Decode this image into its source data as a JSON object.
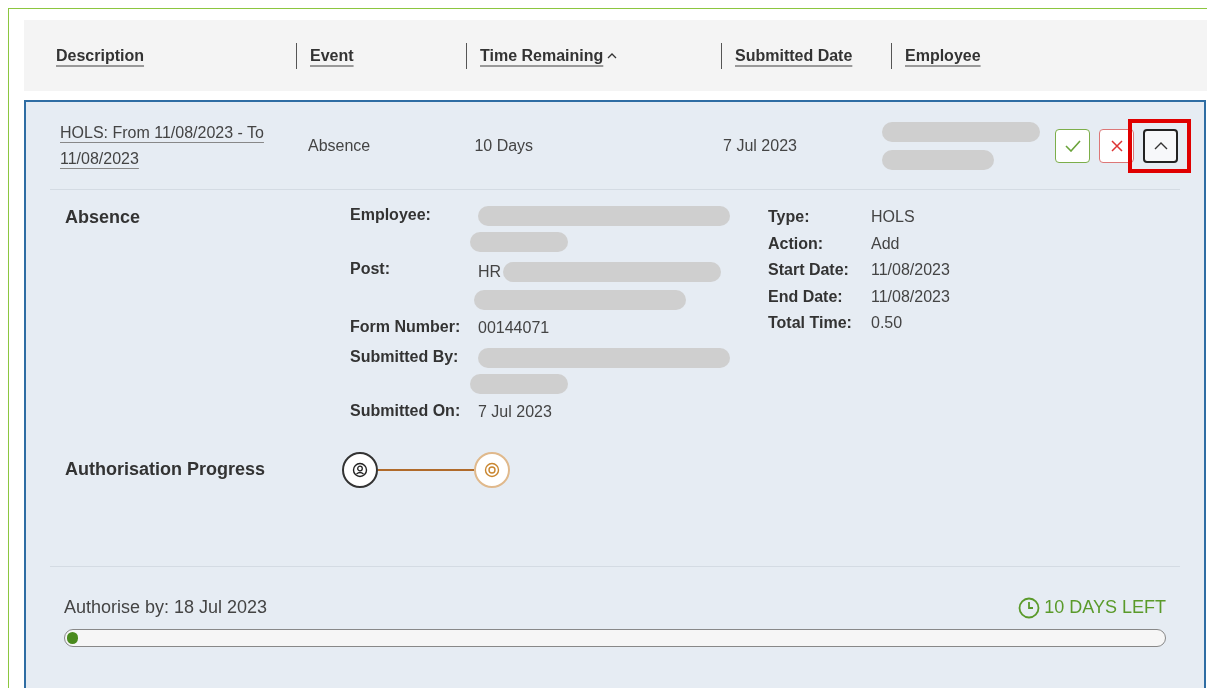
{
  "columns": [
    {
      "label": "Description",
      "sorted": false
    },
    {
      "label": "Event",
      "sorted": false
    },
    {
      "label": "Time Remaining",
      "sorted": true
    },
    {
      "label": "Submitted Date",
      "sorted": false
    },
    {
      "label": "Employee",
      "sorted": false
    }
  ],
  "row": {
    "description": "HOLS: From 11/08/2023 - To 11/08/2023",
    "event": "Absence",
    "time_remaining": "10 Days",
    "submitted_date": "7 Jul 2023",
    "expanded": true,
    "collapse_highlighted": true
  },
  "details": {
    "title": "Absence",
    "left_fields": [
      {
        "label": "Employee:",
        "kind": "redacted"
      },
      {
        "label": "Post:",
        "kind": "partly_redacted",
        "value": "HR"
      },
      {
        "label": "Form Number:",
        "kind": "text",
        "value": "00144071"
      },
      {
        "label": "Submitted By:",
        "kind": "redacted"
      },
      {
        "label": "Submitted On:",
        "kind": "text",
        "value": "7 Jul 2023"
      }
    ],
    "right_fields": [
      {
        "label": "Type:",
        "value": "HOLS"
      },
      {
        "label": "Action:",
        "value": "Add"
      },
      {
        "label": "Start Date:",
        "value": "11/08/2023"
      },
      {
        "label": "End Date:",
        "value": "11/08/2023"
      },
      {
        "label": "Total Time:",
        "value": "0.50"
      }
    ]
  },
  "progress": {
    "title": "Authorisation Progress",
    "steps": [
      {
        "kind": "person",
        "completed": true
      },
      {
        "kind": "target",
        "completed": false
      }
    ]
  },
  "deadline": {
    "label": "Authorise by: 18 Jul 2023",
    "remaining": "10 DAYS LEFT",
    "level": 0.01
  }
}
